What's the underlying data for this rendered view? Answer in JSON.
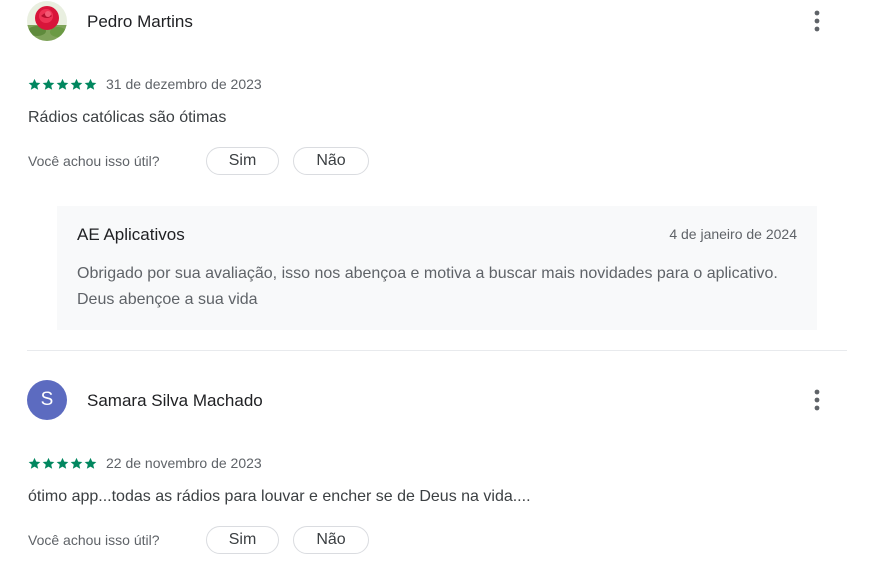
{
  "reviews": [
    {
      "author": "Pedro Martins",
      "avatar_icon": "rose-photo-avatar",
      "stars": 5,
      "date": "31 de dezembro de 2023",
      "text": "Rádios católicas são ótimas",
      "helpful_label": "Você achou isso útil?",
      "yes_label": "Sim",
      "no_label": "Não",
      "reply": {
        "author": "AE Aplicativos",
        "date": "4 de janeiro de 2024",
        "text": "Obrigado por sua avaliação, isso nos abençoa e motiva a buscar mais novidades para o aplicativo. Deus abençoe a sua vida"
      }
    },
    {
      "author": "Samara Silva Machado",
      "avatar_letter": "S",
      "avatar_color": "#5c6bc0",
      "stars": 5,
      "date": "22 de novembro de 2023",
      "text": "ótimo app...todas as rádios para louvar e encher se de Deus na vida....",
      "helpful_label": "Você achou isso útil?",
      "yes_label": "Sim",
      "no_label": "Não"
    }
  ],
  "colors": {
    "star": "#01875f",
    "muted": "#5f6368",
    "reply_bg": "#f8f9fa"
  }
}
